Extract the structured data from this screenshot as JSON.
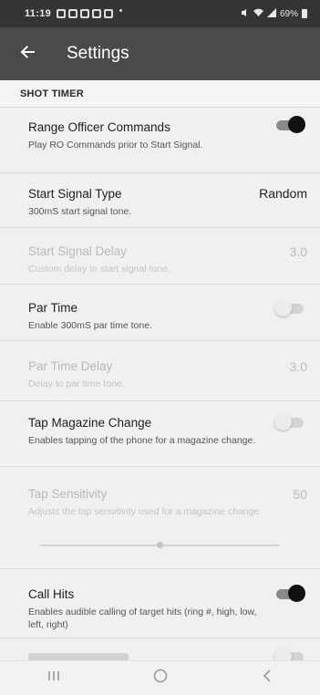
{
  "status_bar": {
    "time": "11:19",
    "battery": "69%"
  },
  "app_bar": {
    "title": "Settings",
    "back_icon": "arrow-left-icon"
  },
  "section": {
    "header": "SHOT TIMER"
  },
  "prefs": {
    "range_officer": {
      "title": "Range Officer Commands",
      "summary": "Play RO Commands prior to Start Signal.",
      "enabled": true,
      "checked": true
    },
    "start_signal_type": {
      "title": "Start Signal Type",
      "summary": "300mS start signal tone.",
      "value": "Random",
      "enabled": true
    },
    "start_signal_delay": {
      "title": "Start Signal Delay",
      "summary": "Custom delay to start signal tone.",
      "value": "3.0",
      "enabled": false
    },
    "par_time": {
      "title": "Par Time",
      "summary": "Enable 300mS par time tone.",
      "enabled": true,
      "checked": false
    },
    "par_time_delay": {
      "title": "Par Time Delay",
      "summary": "Delay to par time tone.",
      "value": "3.0",
      "enabled": false
    },
    "tap_magazine": {
      "title": "Tap Magazine Change",
      "summary": "Enables tapping of the phone for a magazine change.",
      "enabled": true,
      "checked": false
    },
    "tap_sensitivity": {
      "title": "Tap Sensitivity",
      "summary": "Adjusts the tap sensitivity used for a magazine change",
      "value": "50",
      "enabled": false,
      "slider_fraction": 0.5
    },
    "call_hits": {
      "title": "Call Hits",
      "summary": "Enables audible calling of target hits (ring #, high, low, left, right)",
      "enabled": true,
      "checked": true
    },
    "partial_next": {
      "enabled": true,
      "checked": false
    }
  },
  "nav_bar": {
    "recents_icon": "recents-icon",
    "home_icon": "home-icon",
    "back_icon": "back-chevron-icon"
  },
  "colors": {
    "app_bar": "#4a4a4a",
    "status_bar": "#343434",
    "background": "#f0f0f0",
    "toggle_on_thumb": "#111111"
  }
}
